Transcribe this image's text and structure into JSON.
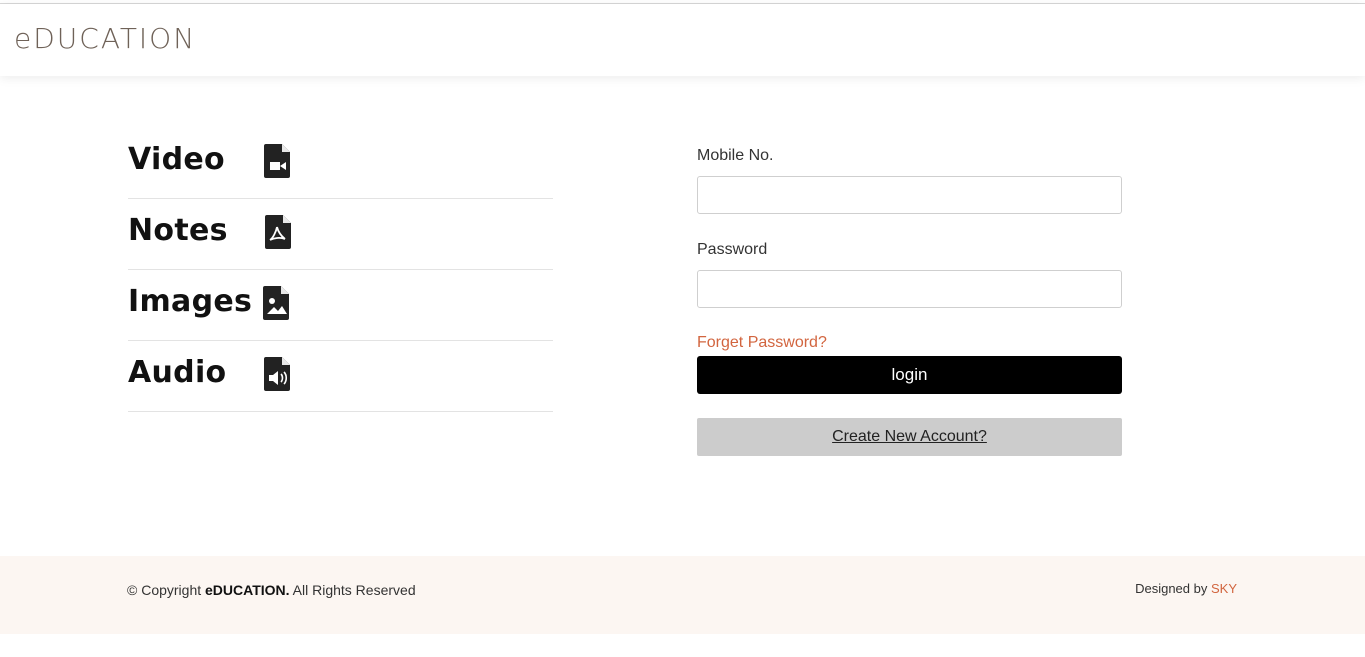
{
  "header": {
    "logo": "eDUCATION"
  },
  "menu": {
    "items": [
      {
        "label": "Video",
        "icon": "file-video-icon"
      },
      {
        "label": "Notes",
        "icon": "file-pdf-icon"
      },
      {
        "label": "Images",
        "icon": "file-image-icon"
      },
      {
        "label": "Audio",
        "icon": "file-audio-icon"
      }
    ]
  },
  "login_form": {
    "mobile_label": "Mobile No.",
    "mobile_value": "",
    "password_label": "Password",
    "password_value": "",
    "forget_link": "Forget Password?",
    "login_button": "login",
    "create_account_button": "Create New Account?"
  },
  "footer": {
    "copyright_prefix": "© Copyright ",
    "brand": "eDUCATION.",
    "rights": " All Rights Reserved",
    "designed_by": "Designed by ",
    "designer": "SKY"
  },
  "colors": {
    "accent": "#d2653f",
    "logo": "#6f6258",
    "footer_bg": "#fcf6f2",
    "login_button_bg": "#000000",
    "create_button_bg": "#cccccc"
  }
}
